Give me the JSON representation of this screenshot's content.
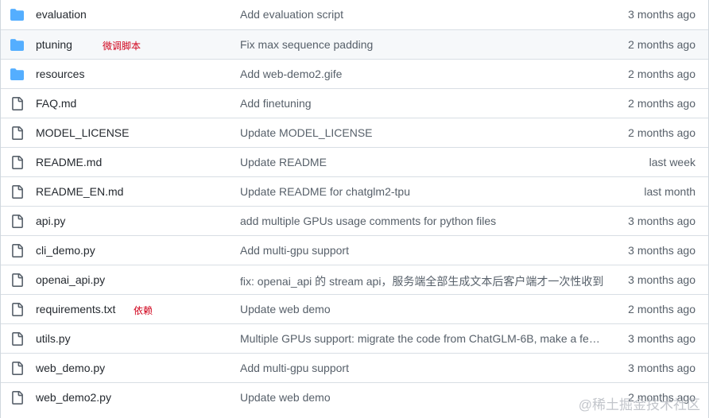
{
  "files": [
    {
      "type": "folder",
      "name": "evaluation",
      "message": "Add evaluation script",
      "age": "3 months ago",
      "annotation": ""
    },
    {
      "type": "folder",
      "name": "ptuning",
      "message": "Fix max sequence padding",
      "age": "2 months ago",
      "annotation": "微调脚本"
    },
    {
      "type": "folder",
      "name": "resources",
      "message": "Add web-demo2.gife",
      "age": "2 months ago",
      "annotation": ""
    },
    {
      "type": "file",
      "name": "FAQ.md",
      "message": "Add finetuning",
      "age": "2 months ago",
      "annotation": ""
    },
    {
      "type": "file",
      "name": "MODEL_LICENSE",
      "message": "Update MODEL_LICENSE",
      "age": "2 months ago",
      "annotation": ""
    },
    {
      "type": "file",
      "name": "README.md",
      "message": "Update README",
      "age": "last week",
      "annotation": ""
    },
    {
      "type": "file",
      "name": "README_EN.md",
      "message": "Update README for chatglm2-tpu",
      "age": "last month",
      "annotation": ""
    },
    {
      "type": "file",
      "name": "api.py",
      "message": "add multiple GPUs usage comments for python files",
      "age": "3 months ago",
      "annotation": ""
    },
    {
      "type": "file",
      "name": "cli_demo.py",
      "message": "Add multi-gpu support",
      "age": "3 months ago",
      "annotation": ""
    },
    {
      "type": "file",
      "name": "openai_api.py",
      "message": "fix: openai_api 的 stream api，服务端全部生成文本后客户端才一次性收到",
      "age": "3 months ago",
      "annotation": ""
    },
    {
      "type": "file",
      "name": "requirements.txt",
      "message": "Update web demo",
      "age": "2 months ago",
      "annotation": "依赖"
    },
    {
      "type": "file",
      "name": "utils.py",
      "message": "Multiple GPUs support: migrate the code from ChatGLM-6B, make a few…",
      "age": "3 months ago",
      "annotation": ""
    },
    {
      "type": "file",
      "name": "web_demo.py",
      "message": "Add multi-gpu support",
      "age": "3 months ago",
      "annotation": ""
    },
    {
      "type": "file",
      "name": "web_demo2.py",
      "message": "Update web demo",
      "age": "2 months ago",
      "annotation": ""
    }
  ],
  "watermark": "@稀土掘金技术社区",
  "colors": {
    "folder_icon": "#54aeff",
    "file_icon": "#57606a",
    "annotation": "#d0021b",
    "muted_text": "#57606a"
  },
  "icons": {
    "folder": "folder-icon",
    "file": "file-icon"
  }
}
